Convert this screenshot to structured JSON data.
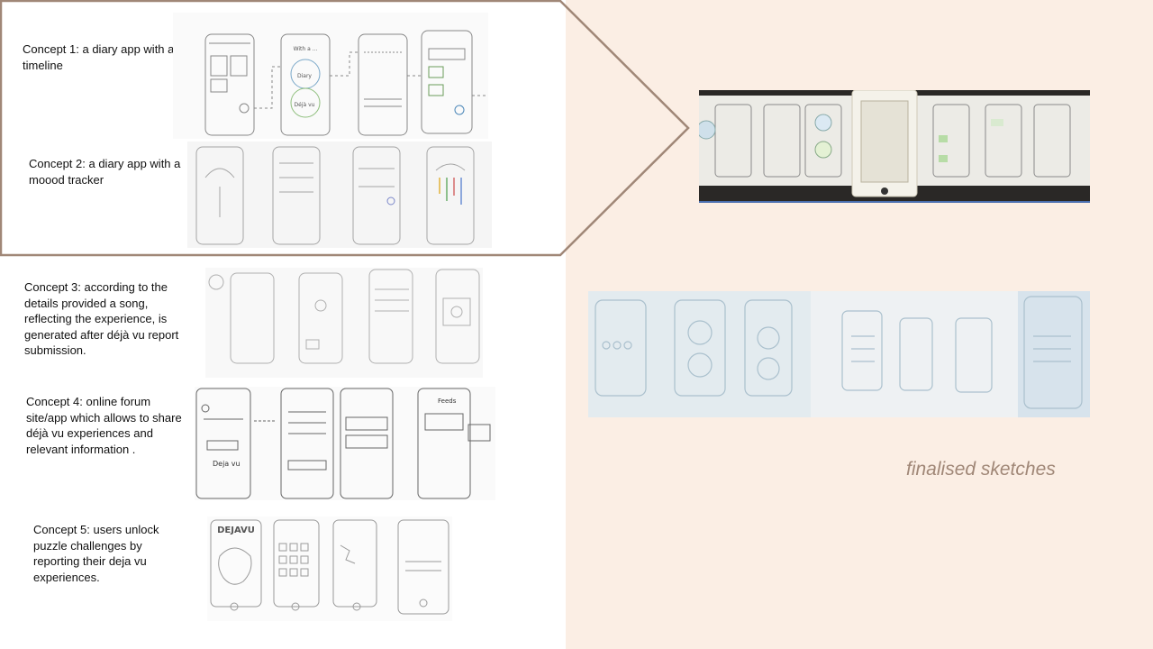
{
  "concepts": [
    {
      "label": "Concept 1: a diary app with a timeline"
    },
    {
      "label": "Concept 2: a diary app with a moood tracker"
    },
    {
      "label": "Concept 3: according to the details provided a song, reflecting the experience, is generated after déjà vu report submission."
    },
    {
      "label": "Concept 4: online forum site/app which allows to share déjà vu experiences and relevant information ."
    },
    {
      "label": "Concept 5: users unlock puzzle challenges by reporting their deja vu experiences."
    }
  ],
  "sketch_texts": {
    "concept1_circle_top": "Diary",
    "concept1_circle_bottom": "Déjà vu",
    "concept1_header": "With a ...",
    "concept4_header": "Deja vu",
    "concept4_feeds": "Feeds",
    "concept5_logo": "DEJAVU"
  },
  "caption": "finalised sketches",
  "colors": {
    "right_panel": "#fbeee4",
    "callout_border": "#a08777",
    "caption": "#a08777"
  }
}
